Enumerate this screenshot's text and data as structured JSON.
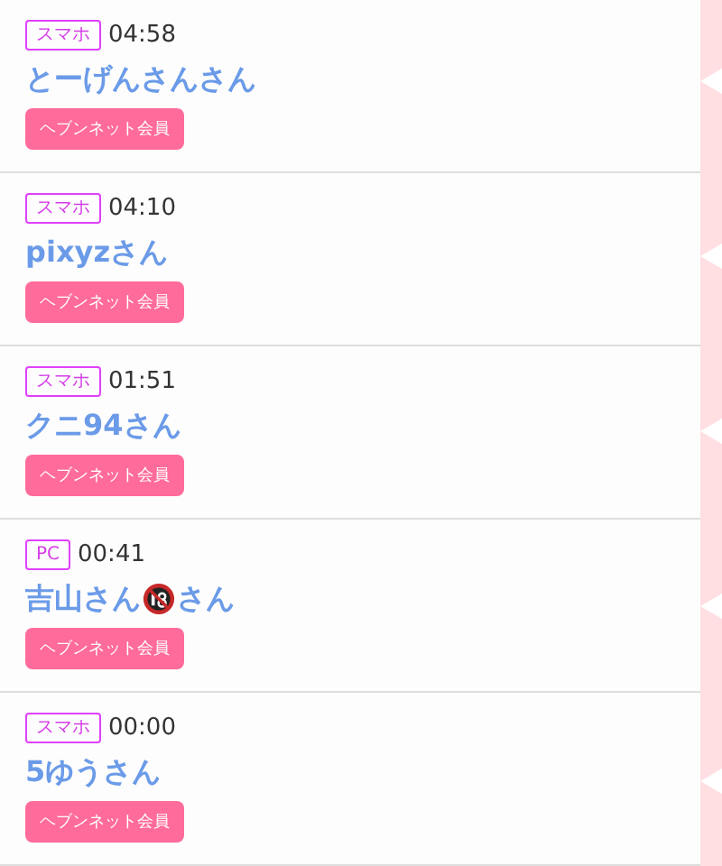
{
  "entries": [
    {
      "device": "スマホ",
      "time": "04:58",
      "name": "とーげんさんさん",
      "member": "ヘブンネット会員"
    },
    {
      "device": "スマホ",
      "time": "04:10",
      "name": "pixyzさん",
      "member": "ヘブンネット会員"
    },
    {
      "device": "スマホ",
      "time": "01:51",
      "name": "クニ94さん",
      "member": "ヘブンネット会員"
    },
    {
      "device": "PC",
      "time": "00:41",
      "name": "吉山さん",
      "name_after_icon": "さん",
      "member": "ヘブンネット会員"
    },
    {
      "device": "スマホ",
      "time": "00:00",
      "name": "5ゆうさん",
      "member": "ヘブンネット会員"
    }
  ]
}
